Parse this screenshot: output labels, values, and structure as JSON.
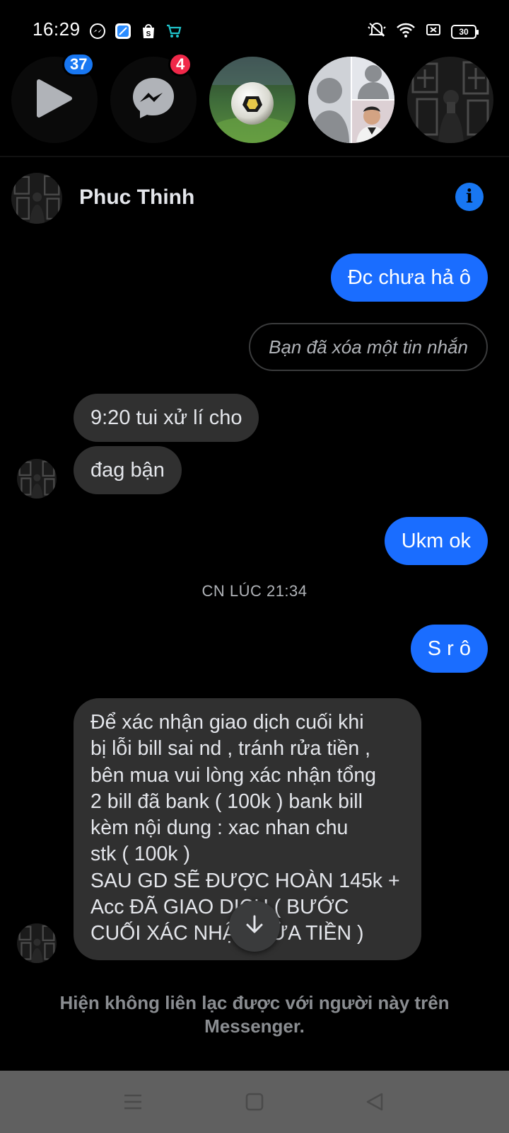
{
  "status_bar": {
    "time": "16:29",
    "battery": "30",
    "notification_icons": [
      "messenger-icon",
      "blue-app-icon",
      "shopee-icon",
      "cart-icon"
    ],
    "system_icons": [
      "mute-icon",
      "wifi-icon",
      "sim-icon",
      "battery-icon"
    ]
  },
  "chat_heads": {
    "items": [
      {
        "name": "watch",
        "icon": "play-icon",
        "badge": "37",
        "badge_color": "#1877f2"
      },
      {
        "name": "messenger",
        "icon": "messenger-icon",
        "badge": "4",
        "badge_color": "#f02849"
      },
      {
        "name": "football-group",
        "icon": "football-avatar"
      },
      {
        "name": "group-chat",
        "icon": "group-avatar"
      },
      {
        "name": "phuc-thinh",
        "icon": "person-avatar"
      }
    ]
  },
  "conversation": {
    "contact_name": "Phuc Thinh",
    "messages": [
      {
        "side": "out",
        "text": "Đc chưa hả ô"
      },
      {
        "side": "deleted",
        "text": "Bạn đã xóa một tin nhắn"
      },
      {
        "side": "in",
        "text": "9:20 tui xử lí cho"
      },
      {
        "side": "in",
        "text": "đag bận"
      },
      {
        "side": "out",
        "text": "Ukm ok"
      },
      {
        "side": "timestamp",
        "text": "CN LÚC 21:34"
      },
      {
        "side": "out",
        "text": "S r ô"
      },
      {
        "side": "in",
        "text": "Để xác nhận giao dịch cuối khi\nbị lỗi bill sai nd , tránh rửa tiền ,\nbên mua vui lòng xác nhận tổng\n2 bill đã bank ( 100k ) bank bill\nkèm nội dung : xac nhan chu\nstk ( 100k )\nSAU GD SẼ ĐƯỢC HOÀN 145k +\nAcc ĐÃ GIAO DỊCH ( BƯỚC\nCUỐI XÁC NHẬN RỬA TIỀN )"
      }
    ],
    "footer_notice": "Hiện không liên lạc được với người này trên Messenger."
  },
  "colors": {
    "accent": "#1877f2",
    "outgoing_bubble": "#1a6dff",
    "incoming_bubble": "#303030",
    "background": "#000000"
  },
  "nav_bar": {
    "buttons": [
      "menu-icon",
      "home-icon",
      "back-icon"
    ]
  }
}
